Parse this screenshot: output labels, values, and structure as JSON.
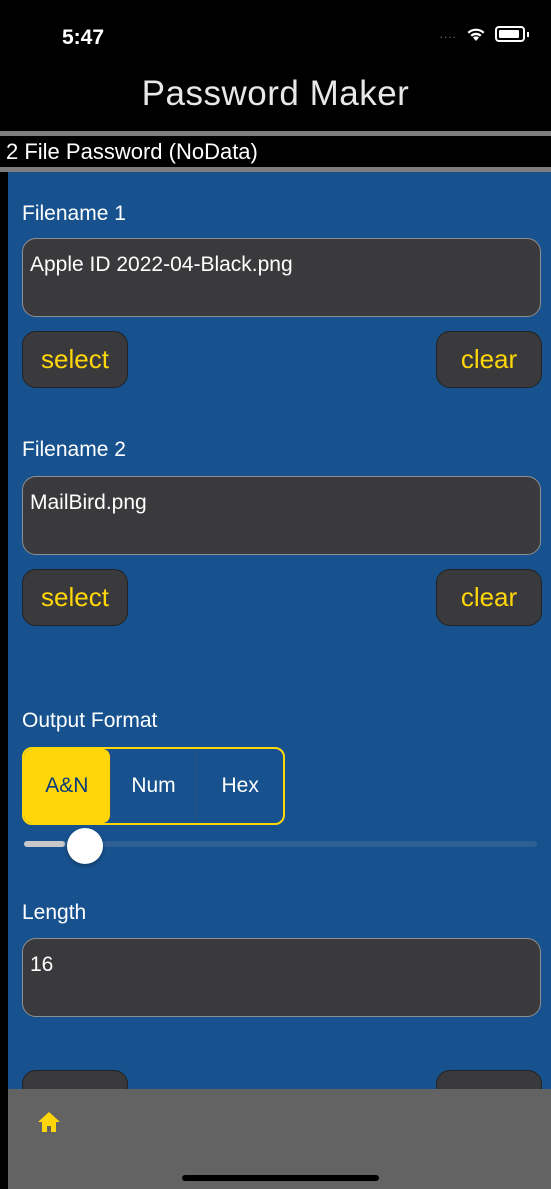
{
  "status": {
    "time": "5:47",
    "signal": "....",
    "wifi": "wifi-icon",
    "battery": "battery-icon"
  },
  "nav": {
    "title": "Password Maker"
  },
  "subtitle": "2 File Password (NoData)",
  "file1": {
    "label": "Filename 1",
    "value": "Apple ID 2022-04-Black.png",
    "select_label": "select",
    "clear_label": "clear"
  },
  "file2": {
    "label": "Filename 2",
    "value": "MailBird.png",
    "select_label": "select",
    "clear_label": "clear"
  },
  "output_format": {
    "label": "Output Format",
    "options": [
      "A&N",
      "Num",
      "Hex"
    ],
    "selected": "A&N"
  },
  "length": {
    "label": "Length",
    "value": "16",
    "slider_fraction": 0.08
  },
  "tabbar": {
    "home_icon": "home-icon"
  },
  "colors": {
    "accent": "#ffd60a",
    "background": "#17528f",
    "field": "#3a3a3c",
    "tabbar": "#636363"
  }
}
